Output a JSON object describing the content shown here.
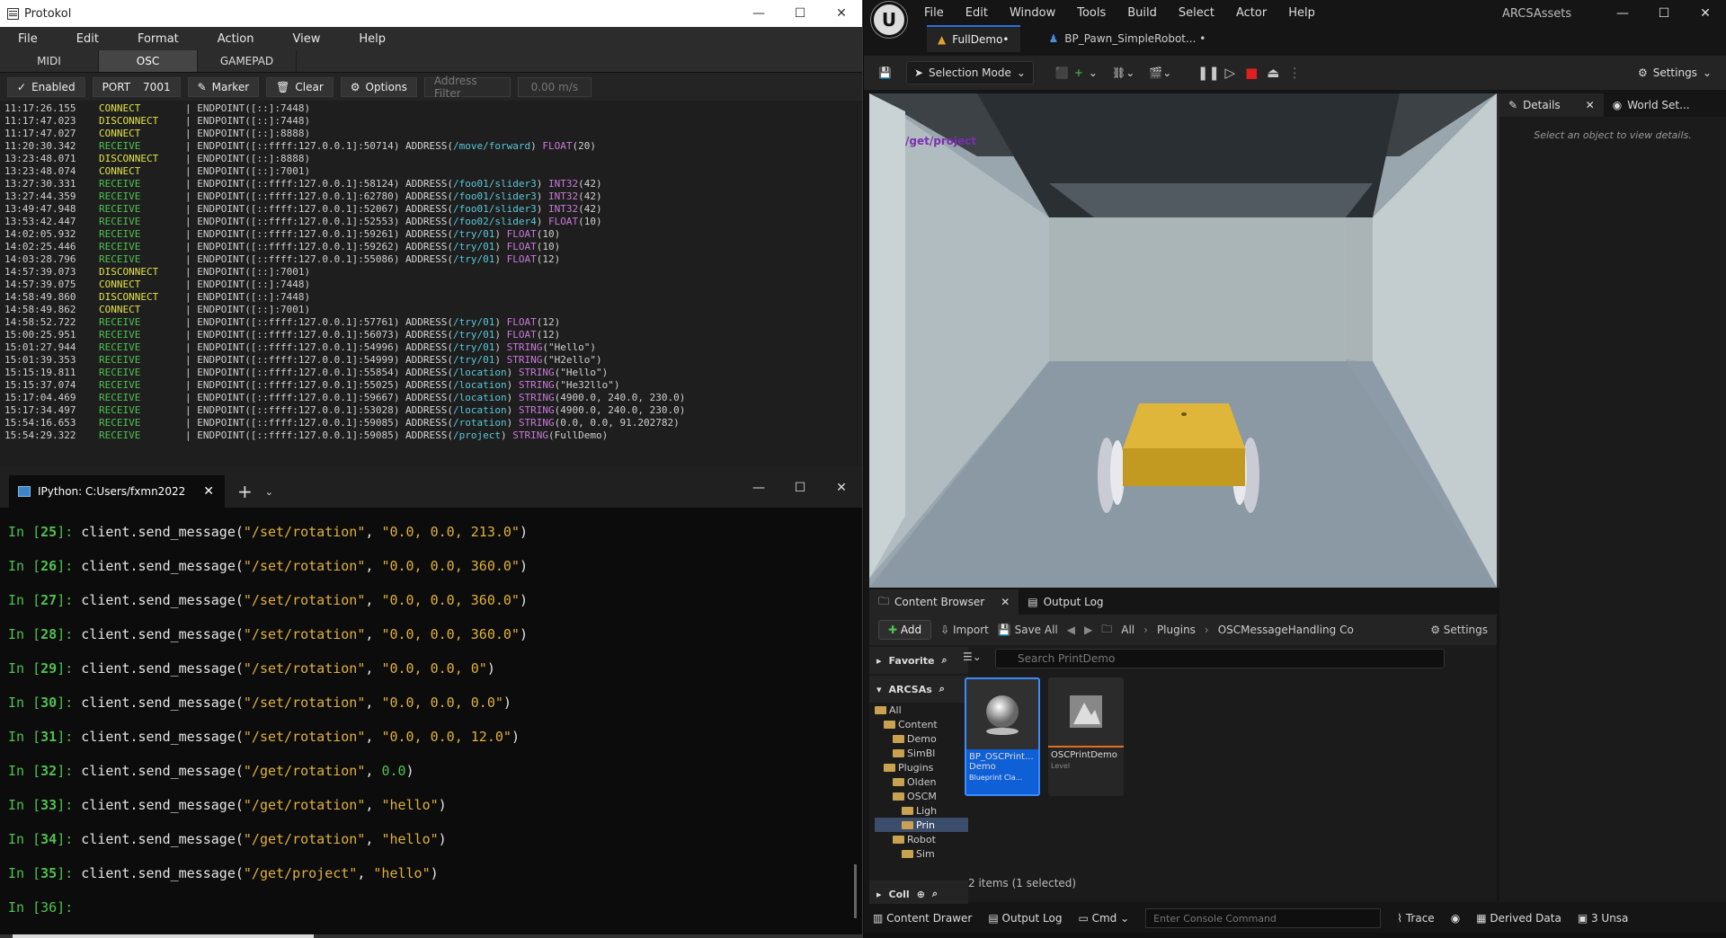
{
  "protokol": {
    "title": "Protokol",
    "menu": [
      "File",
      "Edit",
      "Format",
      "Action",
      "View",
      "Help"
    ],
    "tabs": [
      "MIDI",
      "OSC",
      "GAMEPAD"
    ],
    "active_tab": "OSC",
    "toolbar": {
      "enabled": "Enabled",
      "port_label": "PORT",
      "port_value": "7001",
      "marker": "Marker",
      "clear": "Clear",
      "options": "Options",
      "address_filter_placeholder": "Address Filter",
      "speed": "0.00 m/s"
    },
    "log": [
      {
        "ts": "11:17:26.155",
        "ev": "CONNECT",
        "ep": "[::]:7448",
        "addr": "",
        "typ": "",
        "val": ""
      },
      {
        "ts": "11:17:47.023",
        "ev": "DISCONNECT",
        "ep": "[::]:7448",
        "addr": "",
        "typ": "",
        "val": ""
      },
      {
        "ts": "11:17:47.027",
        "ev": "CONNECT",
        "ep": "[::]:8888",
        "addr": "",
        "typ": "",
        "val": ""
      },
      {
        "ts": "11:20:30.342",
        "ev": "RECEIVE",
        "ep": "[::ffff:127.0.0.1]:50714",
        "addr": "/move/forward",
        "typ": "FLOAT",
        "val": "(20)"
      },
      {
        "ts": "13:23:48.071",
        "ev": "DISCONNECT",
        "ep": "[::]:8888",
        "addr": "",
        "typ": "",
        "val": ""
      },
      {
        "ts": "13:23:48.074",
        "ev": "CONNECT",
        "ep": "[::]:7001",
        "addr": "",
        "typ": "",
        "val": ""
      },
      {
        "ts": "13:27:30.331",
        "ev": "RECEIVE",
        "ep": "[::ffff:127.0.0.1]:58124",
        "addr": "/foo01/slider3",
        "typ": "INT32",
        "val": "(42)"
      },
      {
        "ts": "13:27:44.359",
        "ev": "RECEIVE",
        "ep": "[::ffff:127.0.0.1]:62780",
        "addr": "/foo01/slider3",
        "typ": "INT32",
        "val": "(42)"
      },
      {
        "ts": "13:49:47.948",
        "ev": "RECEIVE",
        "ep": "[::ffff:127.0.0.1]:52067",
        "addr": "/foo01/slider3",
        "typ": "INT32",
        "val": "(42)"
      },
      {
        "ts": "13:53:42.447",
        "ev": "RECEIVE",
        "ep": "[::ffff:127.0.0.1]:52553",
        "addr": "/foo02/slider4",
        "typ": "FLOAT",
        "val": "(10)"
      },
      {
        "ts": "14:02:05.932",
        "ev": "RECEIVE",
        "ep": "[::ffff:127.0.0.1]:59261",
        "addr": "/try/01",
        "typ": "FLOAT",
        "val": "(10)"
      },
      {
        "ts": "14:02:25.446",
        "ev": "RECEIVE",
        "ep": "[::ffff:127.0.0.1]:59262",
        "addr": "/try/01",
        "typ": "FLOAT",
        "val": "(10)"
      },
      {
        "ts": "14:03:28.796",
        "ev": "RECEIVE",
        "ep": "[::ffff:127.0.0.1]:55086",
        "addr": "/try/01",
        "typ": "FLOAT",
        "val": "(12)"
      },
      {
        "ts": "14:57:39.073",
        "ev": "DISCONNECT",
        "ep": "[::]:7001",
        "addr": "",
        "typ": "",
        "val": ""
      },
      {
        "ts": "14:57:39.075",
        "ev": "CONNECT",
        "ep": "[::]:7448",
        "addr": "",
        "typ": "",
        "val": ""
      },
      {
        "ts": "14:58:49.860",
        "ev": "DISCONNECT",
        "ep": "[::]:7448",
        "addr": "",
        "typ": "",
        "val": ""
      },
      {
        "ts": "14:58:49.862",
        "ev": "CONNECT",
        "ep": "[::]:7001",
        "addr": "",
        "typ": "",
        "val": ""
      },
      {
        "ts": "14:58:52.722",
        "ev": "RECEIVE",
        "ep": "[::ffff:127.0.0.1]:57761",
        "addr": "/try/01",
        "typ": "FLOAT",
        "val": "(12)"
      },
      {
        "ts": "15:00:25.951",
        "ev": "RECEIVE",
        "ep": "[::ffff:127.0.0.1]:56073",
        "addr": "/try/01",
        "typ": "FLOAT",
        "val": "(12)"
      },
      {
        "ts": "15:01:27.944",
        "ev": "RECEIVE",
        "ep": "[::ffff:127.0.0.1]:54996",
        "addr": "/try/01",
        "typ": "STRING",
        "val": "(\"Hello\")"
      },
      {
        "ts": "15:01:39.353",
        "ev": "RECEIVE",
        "ep": "[::ffff:127.0.0.1]:54999",
        "addr": "/try/01",
        "typ": "STRING",
        "val": "(\"H2ello\")"
      },
      {
        "ts": "15:15:19.811",
        "ev": "RECEIVE",
        "ep": "[::ffff:127.0.0.1]:55854",
        "addr": "/location",
        "typ": "STRING",
        "val": "(\"Hello\")"
      },
      {
        "ts": "15:15:37.074",
        "ev": "RECEIVE",
        "ep": "[::ffff:127.0.0.1]:55025",
        "addr": "/location",
        "typ": "STRING",
        "val": "(\"He32llo\")"
      },
      {
        "ts": "15:17:04.469",
        "ev": "RECEIVE",
        "ep": "[::ffff:127.0.0.1]:59667",
        "addr": "/location",
        "typ": "STRING",
        "val": "(4900.0, 240.0, 230.0)"
      },
      {
        "ts": "15:17:34.497",
        "ev": "RECEIVE",
        "ep": "[::ffff:127.0.0.1]:53028",
        "addr": "/location",
        "typ": "STRING",
        "val": "(4900.0, 240.0, 230.0)"
      },
      {
        "ts": "15:54:16.653",
        "ev": "RECEIVE",
        "ep": "[::ffff:127.0.0.1]:59085",
        "addr": "/rotation",
        "typ": "STRING",
        "val": "(0.0, 0.0, 91.202782)"
      },
      {
        "ts": "15:54:29.322",
        "ev": "RECEIVE",
        "ep": "[::ffff:127.0.0.1]:59085",
        "addr": "/project",
        "typ": "STRING",
        "val": "(FullDemo)"
      }
    ]
  },
  "ipython": {
    "tab_title": "IPython: C:Users/fxmn2022",
    "lines": [
      {
        "n": "25",
        "fn": "client.send_message(",
        "a": "\"/set/rotation\"",
        "b": "\"0.0, 0.0, 213.0\"",
        "bnum": false
      },
      {
        "n": "26",
        "fn": "client.send_message(",
        "a": "\"/set/rotation\"",
        "b": "\"0.0, 0.0, 360.0\"",
        "bnum": false
      },
      {
        "n": "27",
        "fn": "client.send_message(",
        "a": "\"/set/rotation\"",
        "b": "\"0.0, 0.0, 360.0\"",
        "bnum": false
      },
      {
        "n": "28",
        "fn": "client.send_message(",
        "a": "\"/set/rotation\"",
        "b": "\"0.0, 0.0, 360.0\"",
        "bnum": false
      },
      {
        "n": "29",
        "fn": "client.send_message(",
        "a": "\"/set/rotation\"",
        "b": "\"0.0, 0.0, 0\"",
        "bnum": false
      },
      {
        "n": "30",
        "fn": "client.send_message(",
        "a": "\"/set/rotation\"",
        "b": "\"0.0, 0.0, 0.0\"",
        "bnum": false
      },
      {
        "n": "31",
        "fn": "client.send_message(",
        "a": "\"/set/rotation\"",
        "b": "\"0.0, 0.0, 12.0\"",
        "bnum": false
      },
      {
        "n": "32",
        "fn": "client.send_message(",
        "a": "\"/get/rotation\"",
        "b": "0.0",
        "bnum": true
      },
      {
        "n": "33",
        "fn": "client.send_message(",
        "a": "\"/get/rotation\"",
        "b": "\"hello\"",
        "bnum": false
      },
      {
        "n": "34",
        "fn": "client.send_message(",
        "a": "\"/get/rotation\"",
        "b": "\"hello\"",
        "bnum": false
      },
      {
        "n": "35",
        "fn": "client.send_message(",
        "a": "\"/get/project\"",
        "b": "\"hello\"",
        "bnum": false
      }
    ],
    "prompt": "In [36]:"
  },
  "unreal": {
    "menu": [
      "File",
      "Edit",
      "Window",
      "Tools",
      "Build",
      "Select",
      "Actor",
      "Help"
    ],
    "project": "ARCSAssets",
    "tabs": [
      {
        "label": "FullDemo•",
        "icon": "level-icon"
      },
      {
        "label": "BP_Pawn_SimpleRobot... •",
        "icon": "pawn-icon"
      }
    ],
    "selection_mode": "Selection Mode",
    "settings": "Settings",
    "viewport_text": "/get/project",
    "details_tab": "Details",
    "world_settings_tab": "World Set...",
    "details_hint": "Select an object to view details.",
    "cb_tabs": [
      "Content Browser",
      "Output Log"
    ],
    "cb_toolbar": {
      "add": "Add",
      "import": "Import",
      "save_all": "Save All",
      "crumbs": [
        "All",
        "Plugins",
        "OSCMessageHandling Co"
      ],
      "settings": "Settings"
    },
    "favorites": "Favorite",
    "arcs": "ARCSAs",
    "collections": "Coll",
    "tree": [
      {
        "label": "All",
        "indent": 0,
        "sel": false
      },
      {
        "label": "Content",
        "indent": 1,
        "sel": false
      },
      {
        "label": "Demo",
        "indent": 2,
        "sel": false
      },
      {
        "label": "SimBl",
        "indent": 2,
        "sel": false
      },
      {
        "label": "Plugins",
        "indent": 1,
        "sel": false
      },
      {
        "label": "Olden",
        "indent": 2,
        "sel": false
      },
      {
        "label": "OSCM",
        "indent": 2,
        "sel": false
      },
      {
        "label": "Ligh",
        "indent": 3,
        "sel": false
      },
      {
        "label": "Prin",
        "indent": 3,
        "sel": true
      },
      {
        "label": "Robot",
        "indent": 2,
        "sel": false
      },
      {
        "label": "Sim",
        "indent": 3,
        "sel": false
      }
    ],
    "search_placeholder": "Search PrintDemo",
    "assets": [
      {
        "name": "BP_OSCPrint... Demo",
        "kind": "Blueprint Cla..."
      },
      {
        "name": "OSCPrintDemo",
        "kind": "Level"
      }
    ],
    "items_count": "2 items (1 selected)",
    "statusbar": {
      "content_drawer": "Content Drawer",
      "output_log": "Output Log",
      "cmd": "Cmd",
      "console_placeholder": "Enter Console Command",
      "trace": "Trace",
      "derived_data": "Derived Data",
      "unsaved": "3 Unsa"
    },
    "colors": {
      "accent": "#0f5fd6",
      "robot_body": "#d4a92a",
      "viewport_text": "#7b2fb0"
    }
  }
}
